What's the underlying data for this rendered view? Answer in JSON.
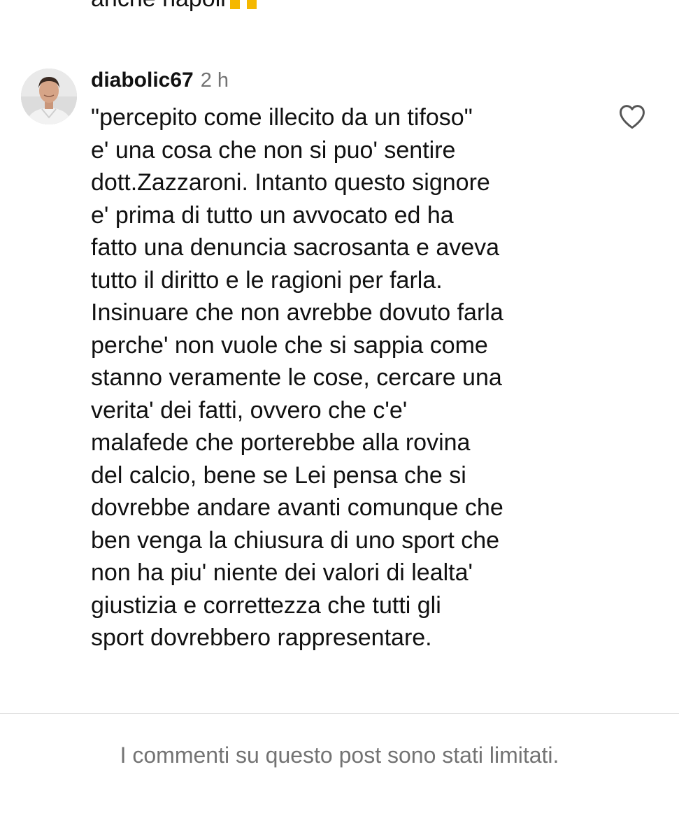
{
  "previous_comment": {
    "text_fragment": "anche napoli"
  },
  "comment": {
    "username": "diabolic67",
    "timestamp": "2 h",
    "avatar_icon": "profile-photo",
    "like_icon": "heart-outline-icon",
    "lines": [
      "\"percepito come illecito da un tifoso\"",
      "e' una cosa che non si puo' sentire",
      "dott.Zazzaroni. Intanto questo signore",
      "e' prima di tutto un avvocato ed ha",
      "fatto una denuncia sacrosanta e aveva",
      "tutto il diritto e le ragioni per farla.",
      "Insinuare che non avrebbe dovuto farla",
      "perche' non vuole che si sappia come",
      "stanno veramente le cose, cercare una",
      "verita' dei fatti, ovvero che c'e'",
      "malafede che porterebbe alla rovina",
      "del calcio, bene se Lei pensa che si",
      "dovrebbe andare avanti comunque che",
      "ben venga la chiusura di uno sport che",
      "non ha piu' niente dei valori di lealta'",
      "giustizia e correttezza che tutti gli",
      "sport dovrebbero rappresentare."
    ]
  },
  "footer": {
    "notice": "I commenti su questo post sono stati limitati."
  },
  "colors": {
    "text_primary": "#111111",
    "text_secondary": "#737373",
    "divider": "#e3e3e3",
    "emoji_yellow": "#f5b800"
  }
}
